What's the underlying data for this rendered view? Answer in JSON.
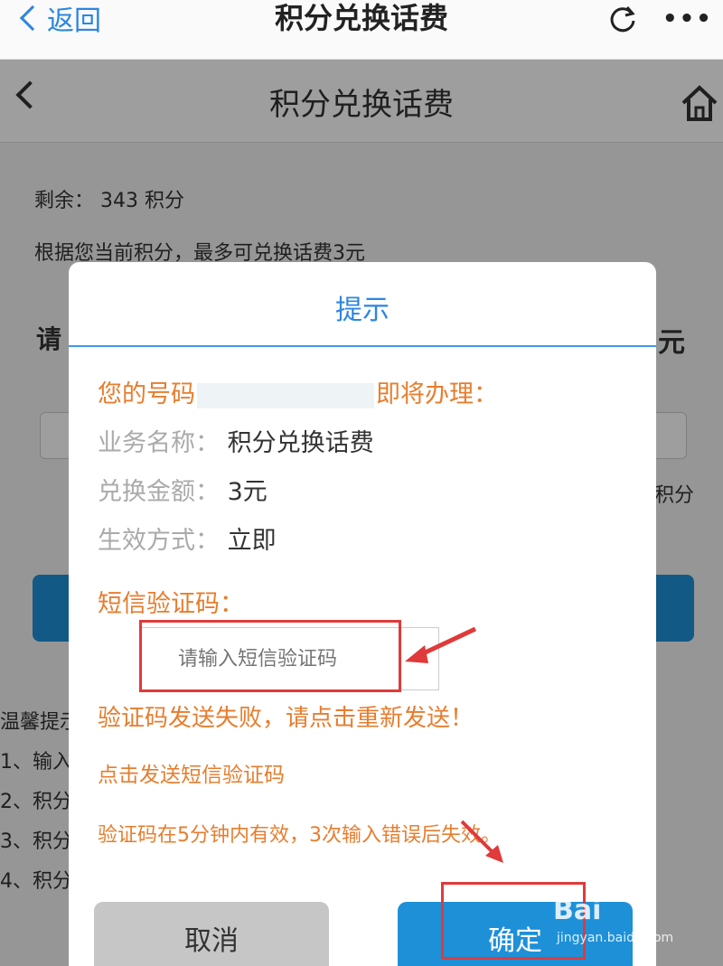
{
  "browser": {
    "back_label": "返回",
    "title": "积分兑换话费",
    "more_label": "•••"
  },
  "page": {
    "title": "积分兑换话费",
    "remaining": "剩余： 343 积分",
    "max_hint": "根据您当前积分，最多可兑换话费3元",
    "partial_left": "请",
    "partial_right_yuan": "元",
    "partial_right_jifen": "积分",
    "tips_lines": [
      "温馨提示",
      "1、输入",
      "2、积分",
      "3、积分",
      "4、积分"
    ]
  },
  "dialog": {
    "title": "提示",
    "number_prefix": "您的号码",
    "number_suffix": "即将办理：",
    "rows": [
      {
        "key": "业务名称：",
        "value": "积分兑换话费"
      },
      {
        "key": "兑换金额：",
        "value": "3元"
      },
      {
        "key": "生效方式：",
        "value": "立即"
      }
    ],
    "sms_label": "短信验证码：",
    "sms_placeholder": "请输入短信验证码",
    "error": "验证码发送失败，请点击重新发送！",
    "send_link": "点击发送短信验证码",
    "validity": "验证码在5分钟内有效，3次输入错误后失效。",
    "cancel": "取消",
    "confirm": "确定"
  },
  "watermark": {
    "brand": "Bai",
    "site": "jingyan.baidu.com"
  },
  "colors": {
    "accent": "#2b86e0",
    "orange": "#e77d2e",
    "annotation_red": "#e03a3a"
  }
}
